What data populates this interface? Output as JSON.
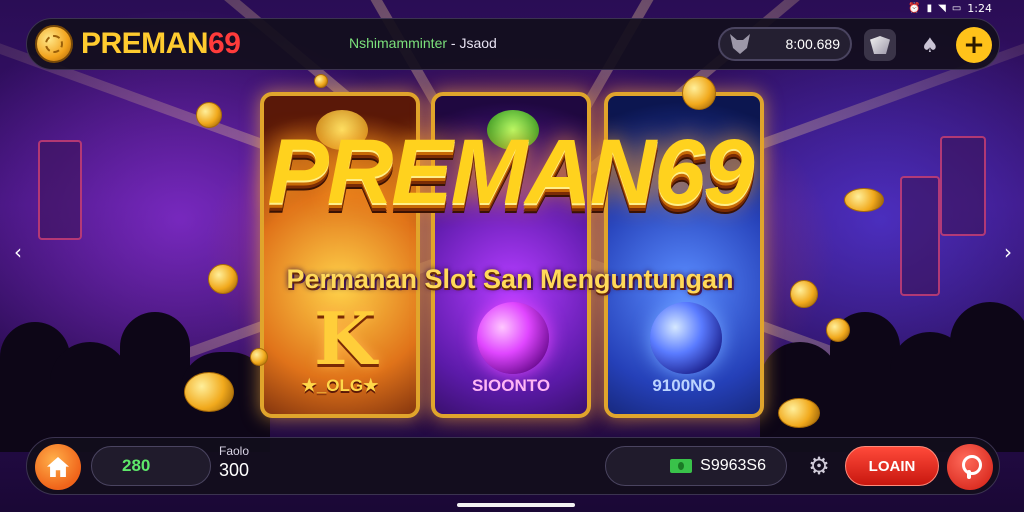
{
  "status_bar": {
    "time": "1:24"
  },
  "header": {
    "logo_text_main": "PREMAN",
    "logo_text_accent": "69",
    "marquee_highlight": "Nshimamminter",
    "marquee_rest": " - Jsaod",
    "balance": "8:00.689"
  },
  "hero": {
    "title": "PREMAN69",
    "subtitle": "Permanan Slot San Menguntungan"
  },
  "games": [
    {
      "label": "★_OLG★",
      "symbol": "K"
    },
    {
      "label": "SIOONTO"
    },
    {
      "label": "9100NO"
    }
  ],
  "footer": {
    "credit": "280",
    "bet_label": "Faolo",
    "bet_value": "300",
    "win_amount": "S9963S6",
    "login_label": "LOAIN"
  },
  "icons": {
    "logo": "coin-icon",
    "balance": "wolf-icon",
    "gift": "gift-icon",
    "spade": "spade-icon",
    "add": "plus-icon",
    "home": "home-icon",
    "cash": "cash-icon",
    "settings": "gear-icon",
    "profile": "profile-icon"
  },
  "colors": {
    "accent_gold": "#ffc21a",
    "accent_red": "#e0251a",
    "credit_green": "#5ee86a"
  }
}
